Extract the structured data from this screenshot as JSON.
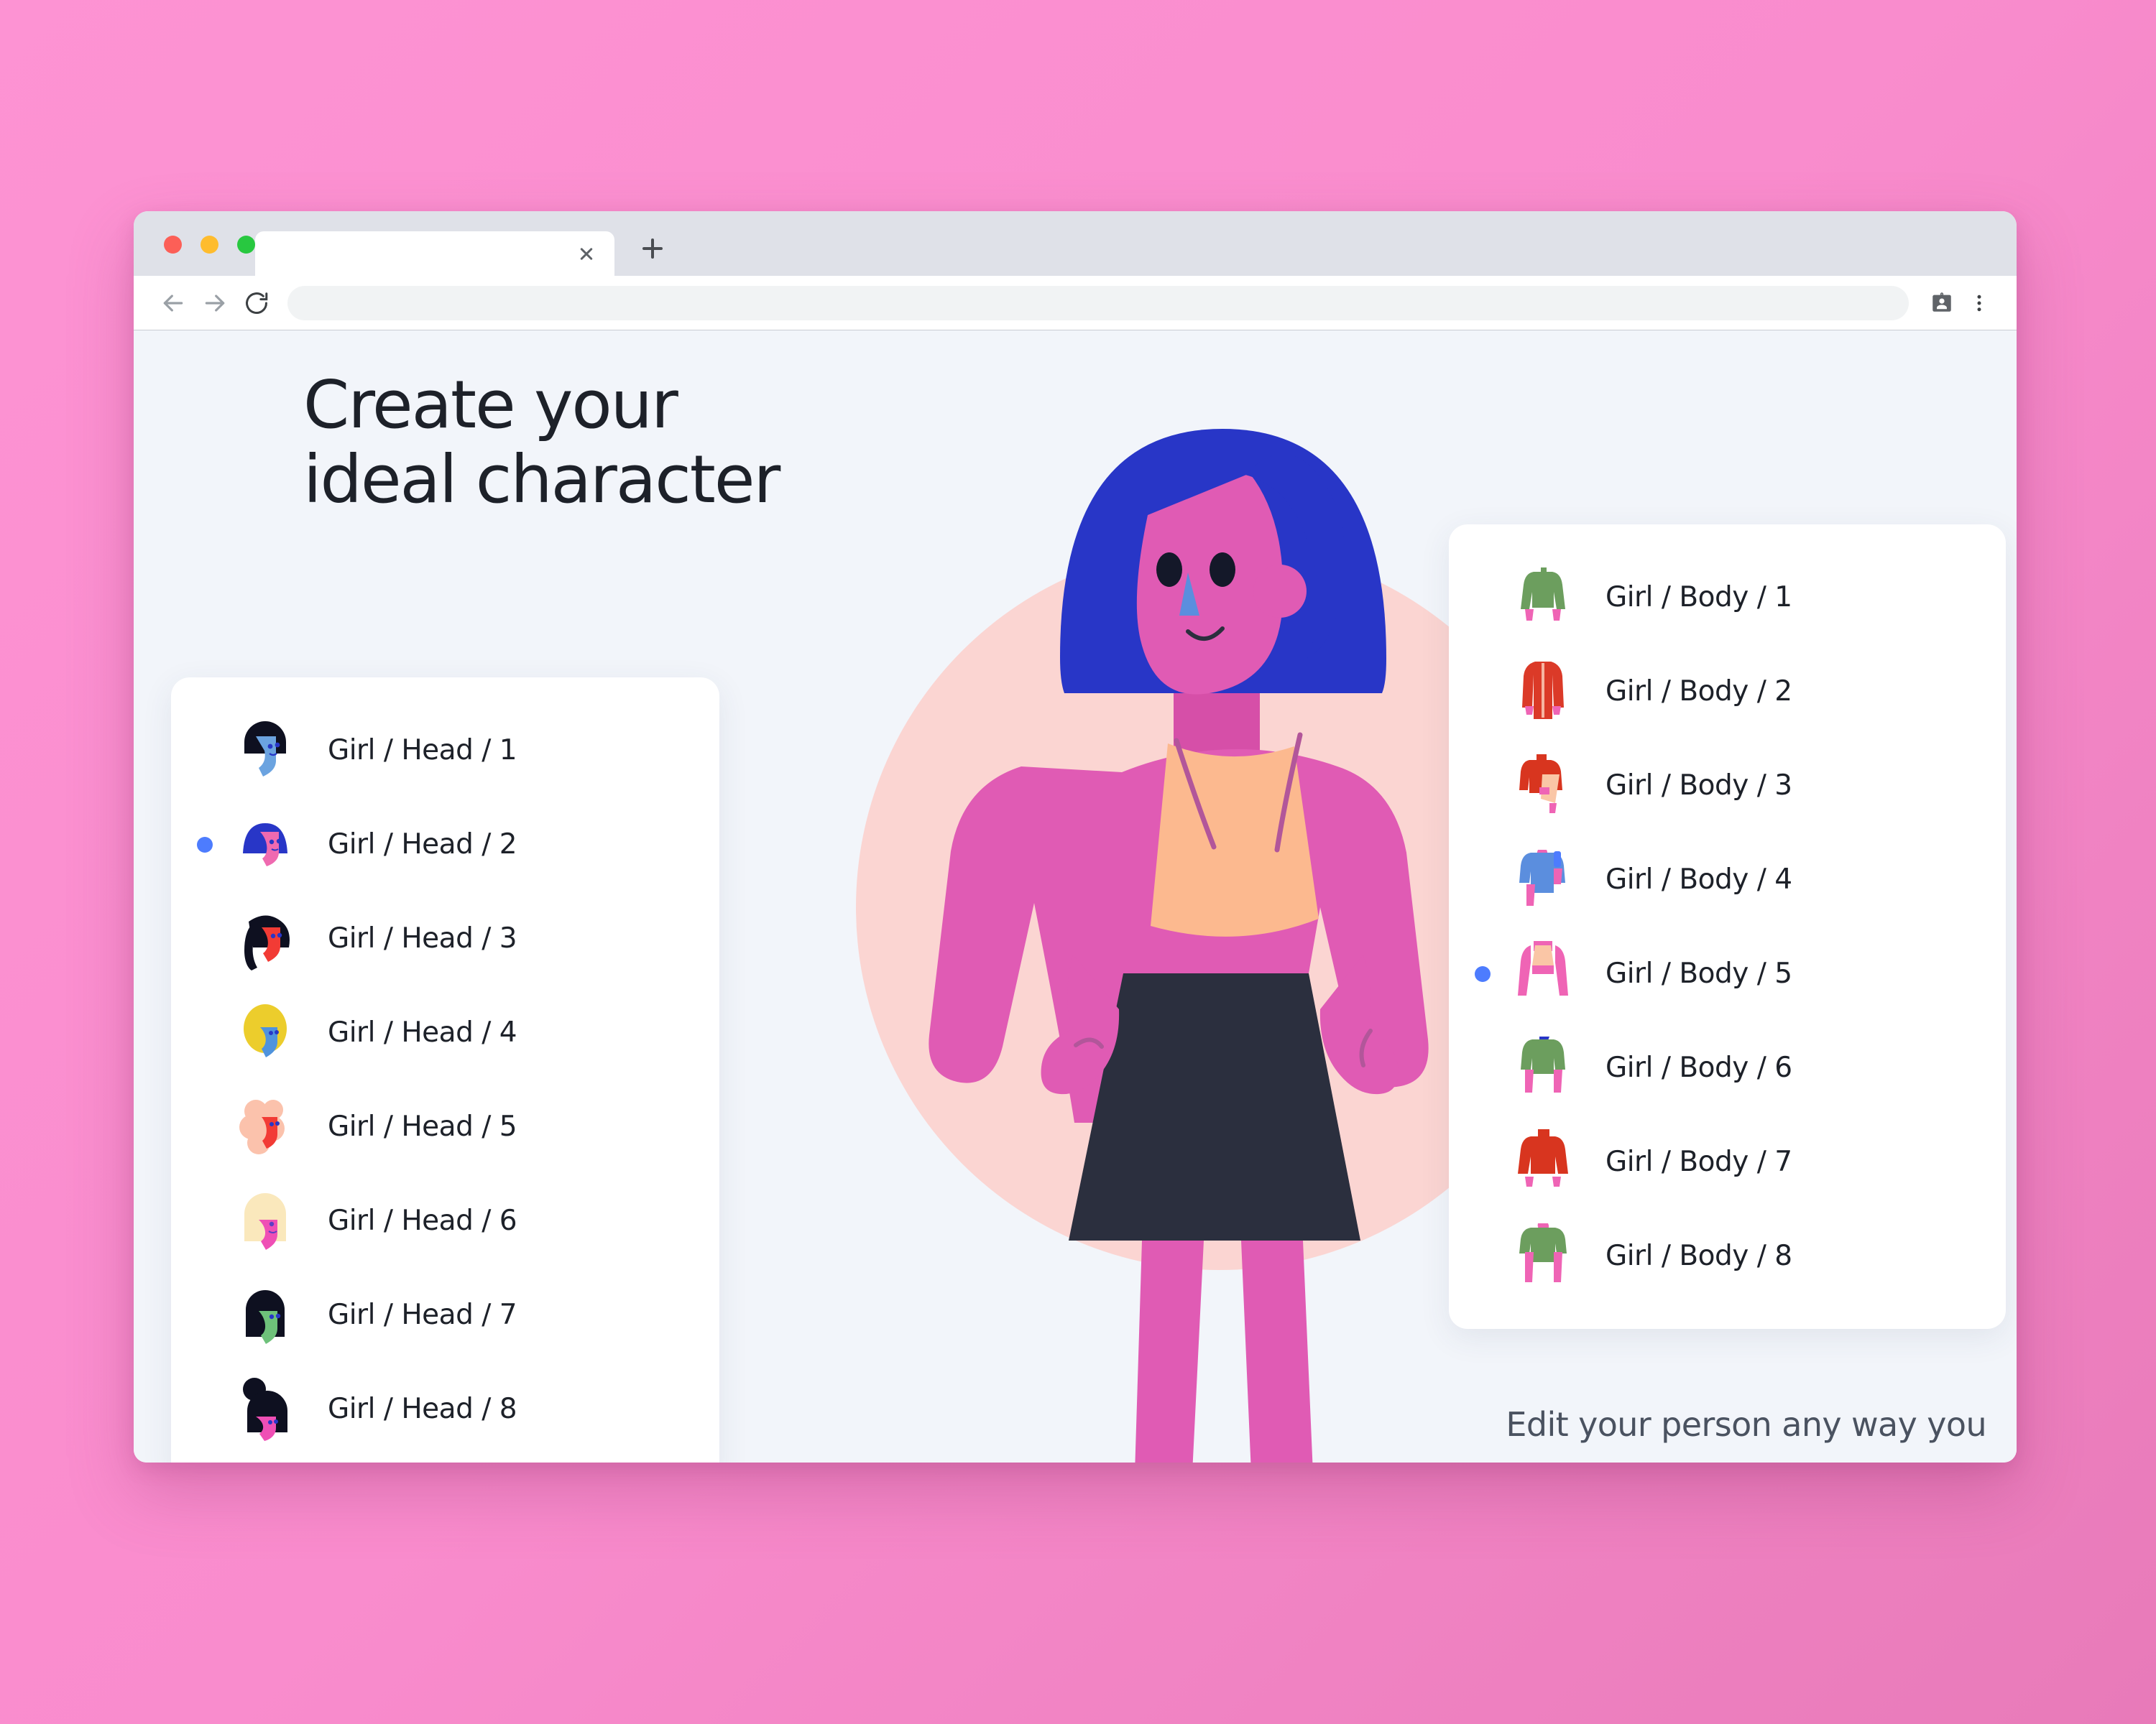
{
  "browser": {
    "traffic_lights": [
      "close-red",
      "minimize-yellow",
      "maximize-green"
    ],
    "tab_title": "",
    "new_tab_label": "+",
    "back_label": "Back",
    "forward_label": "Forward",
    "reload_label": "Reload",
    "address_value": "",
    "address_placeholder": "",
    "profile_icon_label": "Profile card",
    "menu_icon_label": "More"
  },
  "page": {
    "headline_line1": "Create your",
    "headline_line2": "ideal character",
    "caption": "Edit your person any way you",
    "accent_color": "#4d7cfe",
    "background_color": "#f2f5fa",
    "blob_color": "#fbd5d2"
  },
  "head_panel": {
    "selected_index": 1,
    "items": [
      {
        "label": "Girl / Head / 1",
        "hair": "#0e1020",
        "skin": "#6ba3e0",
        "style": "bob"
      },
      {
        "label": "Girl / Head / 2",
        "hair": "#2836c7",
        "skin": "#ef6ab0",
        "style": "dome"
      },
      {
        "label": "Girl / Head / 3",
        "hair": "#0e1020",
        "skin": "#f23b35",
        "style": "ponytail"
      },
      {
        "label": "Girl / Head / 4",
        "hair": "#eccd2c",
        "skin": "#4f93dd",
        "style": "dome"
      },
      {
        "label": "Girl / Head / 5",
        "hair": "#fbc2ac",
        "skin": "#f23b35",
        "style": "curly"
      },
      {
        "label": "Girl / Head / 6",
        "hair": "#fae8bc",
        "skin": "#ef4fb5",
        "style": "long"
      },
      {
        "label": "Girl / Head / 7",
        "hair": "#0e1020",
        "skin": "#6ec17a",
        "style": "long"
      },
      {
        "label": "Girl / Head / 8",
        "hair": "#0e1020",
        "skin": "#ef4fb5",
        "style": "bun"
      }
    ]
  },
  "body_panel": {
    "selected_index": 4,
    "items": [
      {
        "label": "Girl / Body / 1",
        "garment": "#6c9e5e",
        "skin": "#ef64b5",
        "style": "sweater"
      },
      {
        "label": "Girl / Body / 2",
        "garment": "#db3a28",
        "skin": "#ef64b5",
        "style": "long-coat"
      },
      {
        "label": "Girl / Body / 3",
        "garment": "#d8351f",
        "skin": "#ef64b5",
        "accent": "#fac6a6",
        "style": "top-with-bag"
      },
      {
        "label": "Girl / Body / 4",
        "garment": "#5b8ede",
        "skin": "#ef64b5",
        "accent": "#4d7cfe",
        "style": "tee-phone"
      },
      {
        "label": "Girl / Body / 5",
        "garment": "#fac6a6",
        "skin": "#ef64b5",
        "style": "crop-top"
      },
      {
        "label": "Girl / Body / 6",
        "garment": "#6c9e5e",
        "skin": "#ef64b5",
        "accent": "#2836c7",
        "style": "v-neck"
      },
      {
        "label": "Girl / Body / 7",
        "garment": "#d8351f",
        "skin": "#ef64b5",
        "style": "turtleneck"
      },
      {
        "label": "Girl / Body / 8",
        "garment": "#6c9e5e",
        "skin": "#ef64b5",
        "style": "tee"
      }
    ]
  },
  "character": {
    "hair_color": "#2836c7",
    "skin_color": "#e05bb4",
    "top_color": "#fcb98f",
    "skirt_color": "#2b2f3e",
    "nose_color": "#5b8ede",
    "eye_color": "#141829"
  }
}
